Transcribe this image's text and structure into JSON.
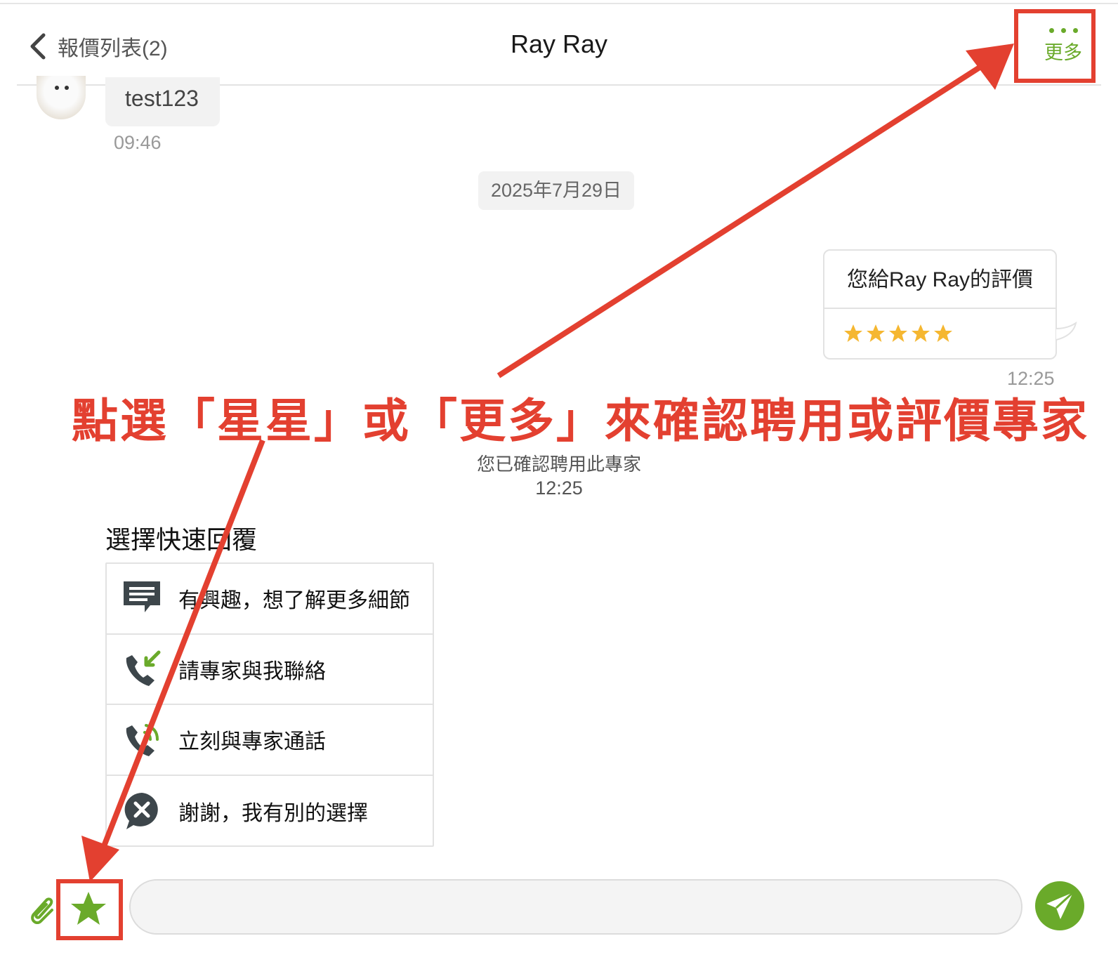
{
  "header": {
    "back_label": "報價列表(2)",
    "title": "Ray Ray",
    "more_label": "更多"
  },
  "chat": {
    "incoming": {
      "text": "test123",
      "time": "09:46"
    },
    "date_chip": "2025年7月29日",
    "rating_card": {
      "title": "您給Ray Ray的評價",
      "stars": 5,
      "time": "12:25"
    },
    "system_message": {
      "text": "您已確認聘用此專家",
      "time": "12:25"
    }
  },
  "quick_replies": {
    "title": "選擇快速回覆",
    "items": [
      {
        "icon": "chat-lines-icon",
        "label": "有興趣，想了解更多細節"
      },
      {
        "icon": "phone-incoming-icon",
        "label": "請專家與我聯絡"
      },
      {
        "icon": "phone-calling-icon",
        "label": "立刻與專家通話"
      },
      {
        "icon": "close-chat-icon",
        "label": "謝謝，我有別的選擇"
      }
    ]
  },
  "annotation": {
    "text": "點選「星星」或「更多」來確認聘用或評價專家"
  },
  "composer": {
    "input_value": "",
    "input_placeholder": ""
  },
  "colors": {
    "accent_green": "#6aaa2a",
    "annotation_red": "#e34030",
    "star_gold": "#f5b731"
  }
}
